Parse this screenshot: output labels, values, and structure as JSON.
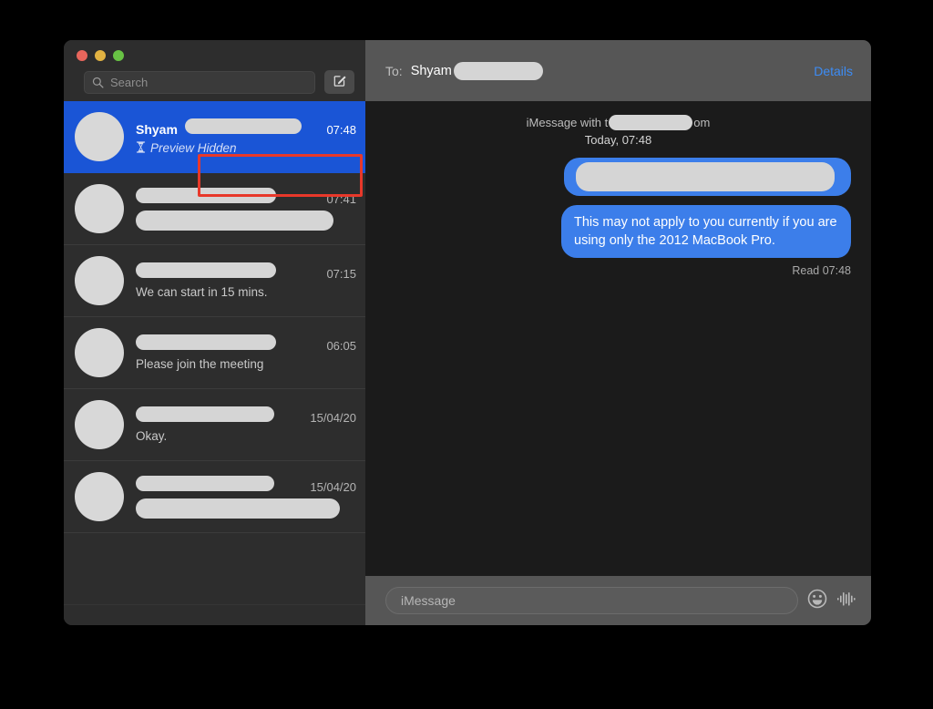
{
  "window": {
    "traffic_lights": {
      "close_color": "#e8665c",
      "minimize_color": "#e2b342",
      "zoom_color": "#68c244"
    }
  },
  "sidebar": {
    "search": {
      "placeholder": "Search",
      "icon": "search-icon"
    },
    "compose": {
      "icon": "compose-pencil-icon",
      "label": ""
    },
    "conversations": [
      {
        "name": "Shyam",
        "name_redacted": true,
        "time": "07:48",
        "preview": "Preview Hidden",
        "preview_icon": "hourglass-icon",
        "preview_redacted": false,
        "selected": true,
        "annotated": true
      },
      {
        "name": "",
        "name_redacted": true,
        "time": "07:41",
        "preview": "",
        "preview_redacted": true,
        "selected": false
      },
      {
        "name": "",
        "name_redacted": true,
        "time": "07:15",
        "preview": "We can start in 15 mins.",
        "preview_redacted": false,
        "selected": false
      },
      {
        "name": "",
        "name_redacted": true,
        "time": "06:05",
        "preview": "Please join the meeting",
        "preview_redacted": false,
        "selected": false
      },
      {
        "name": "",
        "name_redacted": true,
        "time": "15/04/20",
        "preview": "Okay.",
        "preview_redacted": false,
        "selected": false
      },
      {
        "name": "",
        "name_redacted": true,
        "time": "15/04/20",
        "preview": "",
        "preview_redacted": true,
        "selected": false
      }
    ]
  },
  "conversation": {
    "header": {
      "to_label": "To:",
      "recipient_name": "Shyam",
      "recipient_redacted": true,
      "details_label": "Details"
    },
    "thread_meta": {
      "prefix": "iMessage with t",
      "suffix": "om",
      "date_line": "Today, 07:48"
    },
    "messages": [
      {
        "id": "bubble-1",
        "direction": "outgoing",
        "redacted": true,
        "text": ""
      },
      {
        "id": "bubble-2",
        "direction": "outgoing",
        "redacted": false,
        "text": "This may not apply to you currently if you are using only the 2012 MacBook Pro."
      }
    ],
    "read_receipt": "Read 07:48",
    "compose": {
      "placeholder": "iMessage",
      "emoji_icon": "smiley-face-icon",
      "audio_icon": "audio-waveform-icon"
    }
  },
  "annotation": {
    "color": "#e8382a",
    "target": "preview-hidden-row"
  }
}
